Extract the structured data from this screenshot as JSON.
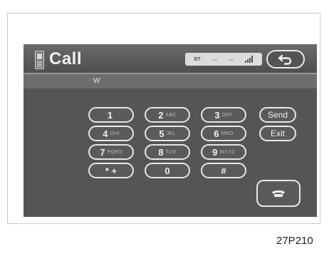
{
  "header": {
    "title": "Call",
    "status_labels": [
      "BT",
      "...",
      "..."
    ]
  },
  "number_display": "W",
  "keypad": [
    {
      "digit": "1",
      "letters": ""
    },
    {
      "digit": "2",
      "letters": "ABC"
    },
    {
      "digit": "3",
      "letters": "DEF"
    },
    {
      "digit": "4",
      "letters": "GHI"
    },
    {
      "digit": "5",
      "letters": "JKL"
    },
    {
      "digit": "6",
      "letters": "MNO"
    },
    {
      "digit": "7",
      "letters": "PQRS"
    },
    {
      "digit": "8",
      "letters": "TUV"
    },
    {
      "digit": "9",
      "letters": "WXYZ"
    },
    {
      "digit": "* +",
      "letters": ""
    },
    {
      "digit": "0",
      "letters": ""
    },
    {
      "digit": "#",
      "letters": ""
    }
  ],
  "buttons": {
    "send": "Send",
    "exit": "Exit"
  },
  "caption": "27P210",
  "colors": {
    "screen_bg": "#555555",
    "header_bg": "#5e5e5e",
    "button_border": "#e6e6e6"
  }
}
